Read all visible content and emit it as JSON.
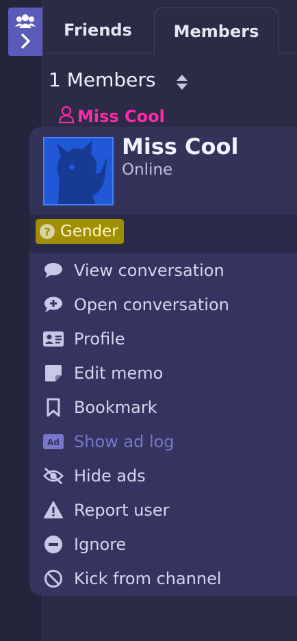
{
  "tabs": {
    "friends": "Friends",
    "members": "Members"
  },
  "members_header": {
    "count_label": "1 Members"
  },
  "member": {
    "name": "Miss Cool"
  },
  "popup": {
    "name": "Miss Cool",
    "status": "Online",
    "gender_label": "Gender",
    "menu": [
      {
        "label": "View conversation",
        "icon": "speech-bubble-icon"
      },
      {
        "label": "Open conversation",
        "icon": "add-conversation-icon"
      },
      {
        "label": "Profile",
        "icon": "id-card-icon"
      },
      {
        "label": "Edit memo",
        "icon": "sticky-note-icon"
      },
      {
        "label": "Bookmark",
        "icon": "bookmark-icon"
      },
      {
        "label": "Show ad log",
        "icon": "ad-icon"
      },
      {
        "label": "Hide ads",
        "icon": "eye-slash-icon"
      },
      {
        "label": "Report user",
        "icon": "warning-icon"
      },
      {
        "label": "Ignore",
        "icon": "minus-circle-icon"
      },
      {
        "label": "Kick from channel",
        "icon": "ban-icon"
      }
    ]
  },
  "colors": {
    "accent": "#5a5ab8",
    "member_name": "#ff2aa8",
    "gender_badge": "#a09000",
    "background": "#2b2b45"
  }
}
